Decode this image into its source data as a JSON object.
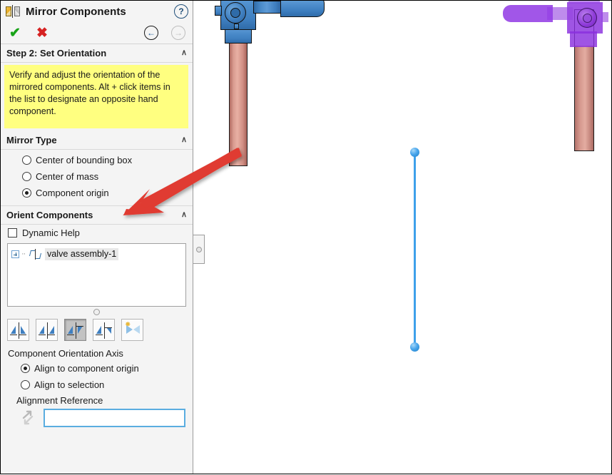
{
  "panel": {
    "title": "Mirror Components",
    "title_icon": "mirror-components-icon",
    "help_icon": "help-question-icon",
    "actions": {
      "ok_label": "✔",
      "ok_name": "accept-checkmark-icon",
      "cancel_label": "✖",
      "cancel_name": "cancel-x-icon",
      "back_label": "←",
      "forward_label": "→"
    },
    "step_section": {
      "title": "Step 2: Set Orientation",
      "collapse_chevron": "∧",
      "help_text": "Verify and adjust the orientation of the mirrored components. Alt + click items in the list to designate an opposite hand component."
    },
    "mirror_type": {
      "title": "Mirror Type",
      "collapse_chevron": "∧",
      "options": [
        {
          "label": "Center of bounding box",
          "selected": false
        },
        {
          "label": "Center of mass",
          "selected": false
        },
        {
          "label": "Component origin",
          "selected": true
        }
      ]
    },
    "orient_components": {
      "title": "Orient Components",
      "collapse_chevron": "∧",
      "dynamic_help": {
        "label": "Dynamic Help",
        "checked": false
      },
      "tree_items": [
        {
          "label": "valve assembly-1",
          "expander": "+",
          "selected": true
        }
      ],
      "toolbar": [
        {
          "name": "mirror-orientation-1",
          "pressed": false
        },
        {
          "name": "mirror-orientation-2",
          "pressed": false
        },
        {
          "name": "mirror-orientation-3",
          "pressed": true
        },
        {
          "name": "mirror-orientation-4",
          "pressed": false
        },
        {
          "name": "mirror-preview-toggle",
          "pressed": false
        }
      ]
    },
    "orientation_axis": {
      "label": "Component Orientation Axis",
      "options": [
        {
          "label": "Align to component origin",
          "selected": true
        },
        {
          "label": "Align to selection",
          "selected": false
        }
      ],
      "alignment_reference_label": "Alignment Reference",
      "alignment_reference_value": "",
      "alignment_reference_placeholder": ""
    }
  },
  "viewport": {
    "original_model": {
      "name": "valve-assembly-original",
      "body_color": "#3f7fc0",
      "pipe_color": "#d99b90"
    },
    "mirrored_preview": {
      "name": "valve-assembly-mirrored-preview",
      "body_color": "#8a30de",
      "pipe_color": "#c2837a"
    },
    "mirror_axis": {
      "name": "mirror-plane-axis",
      "color": "#3ea0ea"
    },
    "annotation": {
      "name": "red-callout-arrow",
      "color": "#e03b30"
    }
  }
}
